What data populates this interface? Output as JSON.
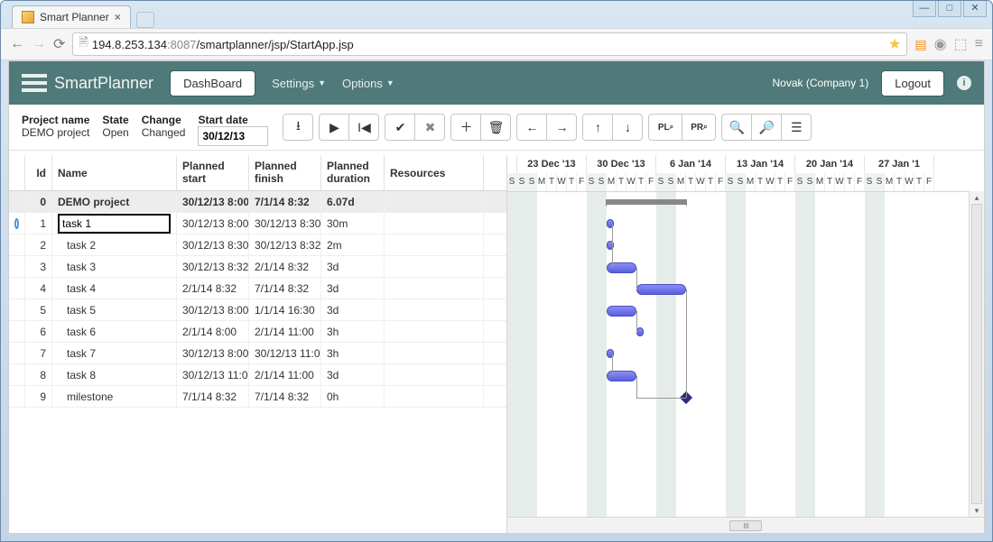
{
  "browser": {
    "tab_title": "Smart Planner",
    "url_host": "194.8.253.134",
    "url_port": ":8087",
    "url_path": "/smartplanner/jsp/StartApp.jsp"
  },
  "appnav": {
    "brand": "SmartPlanner",
    "dashboard": "DashBoard",
    "settings": "Settings",
    "options": "Options",
    "user": "Novak (Company 1)",
    "logout": "Logout"
  },
  "meta": {
    "project_name_lbl": "Project name",
    "project_name_val": "DEMO project",
    "state_lbl": "State",
    "state_val": "Open",
    "change_lbl": "Change",
    "change_val": "Changed",
    "startdate_lbl": "Start date",
    "startdate_val": "30/12/13"
  },
  "toolbar": {
    "pl": "PL",
    "pr": "PR"
  },
  "grid": {
    "headers": {
      "id": "Id",
      "name": "Name",
      "planned_start1": "Planned",
      "planned_start2": "start",
      "planned_finish1": "Planned",
      "planned_finish2": "finish",
      "planned_dur1": "Planned",
      "planned_dur2": "duration",
      "resources": "Resources"
    },
    "rows": [
      {
        "id": "0",
        "name": "DEMO project",
        "start": "30/12/13 8:00",
        "finish": "7/1/14 8:32",
        "dur": "6.07d",
        "res": "",
        "summary": true
      },
      {
        "id": "1",
        "name": "task 1",
        "start": "30/12/13 8:00",
        "finish": "30/12/13 8:30",
        "dur": "30m",
        "res": "",
        "info": true,
        "editing": true
      },
      {
        "id": "2",
        "name": "task 2",
        "start": "30/12/13 8:30",
        "finish": "30/12/13 8:32",
        "dur": "2m",
        "res": ""
      },
      {
        "id": "3",
        "name": "task 3",
        "start": "30/12/13 8:32",
        "finish": "2/1/14 8:32",
        "dur": "3d",
        "res": ""
      },
      {
        "id": "4",
        "name": "task 4",
        "start": "2/1/14 8:32",
        "finish": "7/1/14 8:32",
        "dur": "3d",
        "res": ""
      },
      {
        "id": "5",
        "name": "task 5",
        "start": "30/12/13 8:00",
        "finish": "1/1/14 16:30",
        "dur": "3d",
        "res": ""
      },
      {
        "id": "6",
        "name": "task 6",
        "start": "2/1/14 8:00",
        "finish": "2/1/14 11:00",
        "dur": "3h",
        "res": ""
      },
      {
        "id": "7",
        "name": "task 7",
        "start": "30/12/13 8:00",
        "finish": "30/12/13 11:00",
        "dur": "3h",
        "res": ""
      },
      {
        "id": "8",
        "name": "task 8",
        "start": "30/12/13 11:0",
        "finish": "2/1/14 11:00",
        "dur": "3d",
        "res": ""
      },
      {
        "id": "9",
        "name": "milestone",
        "start": "7/1/14 8:32",
        "finish": "7/1/14 8:32",
        "dur": "0h",
        "res": ""
      }
    ]
  },
  "timeline": {
    "weeks": [
      "23 Dec '13",
      "30 Dec '13",
      "6 Jan '14",
      "13 Jan '14",
      "20 Jan '14",
      "27 Jan '1"
    ],
    "days_pattern": [
      "S",
      "S",
      "M",
      "T",
      "W",
      "T",
      "F",
      "S",
      "S",
      "M",
      "T",
      "W",
      "T",
      "F",
      "S",
      "S",
      "M",
      "T",
      "W",
      "T",
      "F",
      "S",
      "S",
      "M",
      "T",
      "W",
      "T",
      "F",
      "S",
      "S",
      "M",
      "T",
      "W",
      "T",
      "F",
      "S",
      "S",
      "M",
      "T",
      "W",
      "T",
      "F"
    ],
    "lead_partial": "S"
  }
}
